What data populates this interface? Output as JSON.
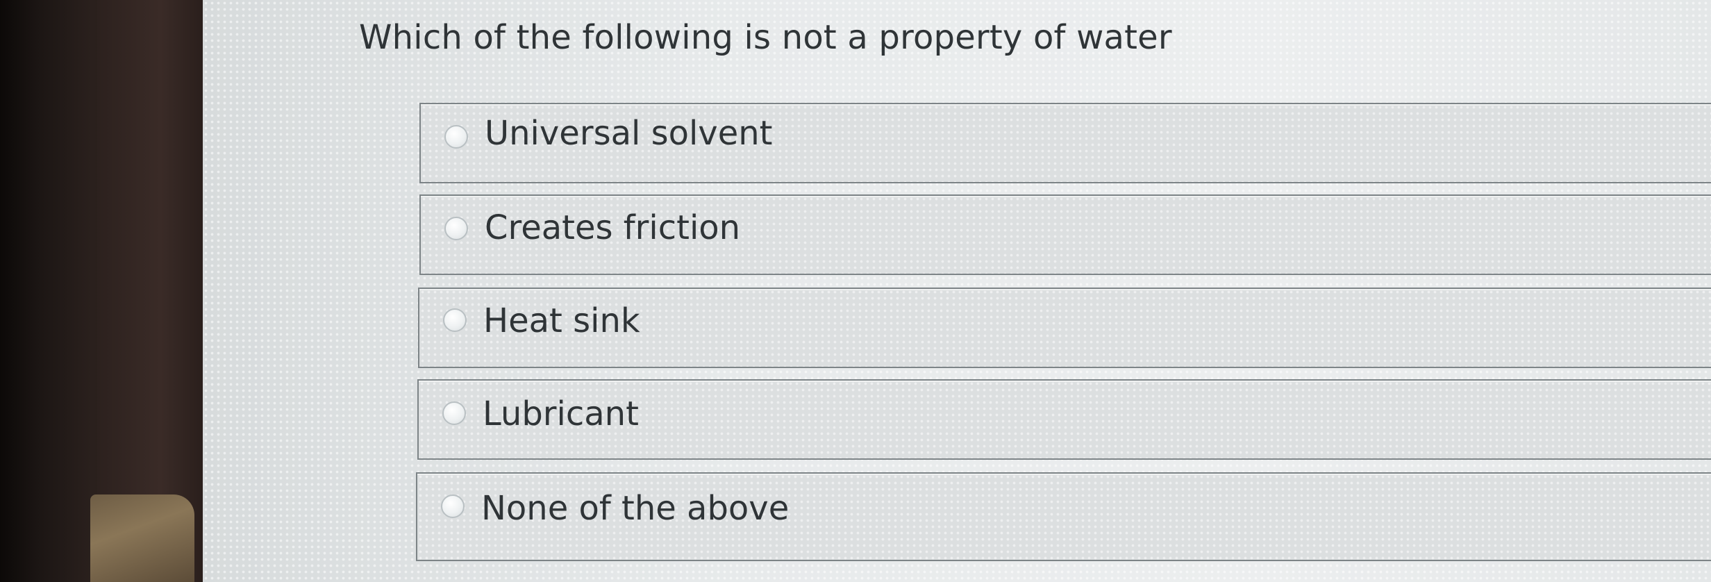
{
  "question": {
    "text": "Which of the following is not a property of water"
  },
  "options": [
    {
      "label": "Universal solvent",
      "selected": false
    },
    {
      "label": "Creates friction",
      "selected": false
    },
    {
      "label": "Heat sink",
      "selected": false
    },
    {
      "label": "Lubricant",
      "selected": false
    },
    {
      "label": "None of the above",
      "selected": false
    }
  ]
}
